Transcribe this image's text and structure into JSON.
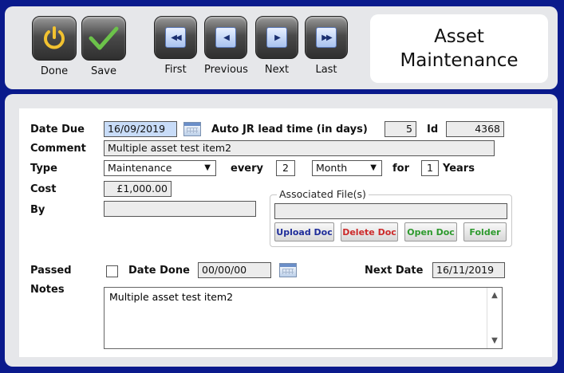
{
  "toolbar": {
    "done_label": "Done",
    "save_label": "Save",
    "first_label": "First",
    "previous_label": "Previous",
    "next_label": "Next",
    "last_label": "Last",
    "title_line1": "Asset",
    "title_line2": "Maintenance"
  },
  "icons": {
    "done": "power-icon",
    "save": "checkmark-icon",
    "first": "first-record-icon",
    "previous": "previous-record-icon",
    "next": "next-record-icon",
    "last": "last-record-icon"
  },
  "form": {
    "date_due_label": "Date Due",
    "date_due_value": "16/09/2019",
    "lead_time_label": "Auto JR lead time (in days)",
    "lead_time_value": "5",
    "id_label": "Id",
    "id_value": "4368",
    "comment_label": "Comment",
    "comment_value": "Multiple asset test item2",
    "type_label": "Type",
    "type_value": "Maintenance",
    "every_label": "every",
    "every_value": "2",
    "period_value": "Month",
    "for_label": "for",
    "for_value": "1",
    "years_label": "Years",
    "cost_label": "Cost",
    "cost_value": "£1,000.00",
    "by_label": "By",
    "by_value": "",
    "passed_label": "Passed",
    "passed_checked": false,
    "date_done_label": "Date Done",
    "date_done_value": "00/00/00",
    "next_date_label": "Next Date",
    "next_date_value": "16/11/2019",
    "notes_label": "Notes",
    "notes_value": "Multiple asset test item2"
  },
  "associated_files": {
    "legend": "Associated File(s)",
    "file_value": "",
    "upload_label": "Upload Doc",
    "delete_label": "Delete Doc",
    "open_label": "Open Doc",
    "folder_label": "Folder"
  },
  "colors": {
    "background": "#0a1a8c",
    "panel": "#e6e7ea",
    "done_icon": "#f2c230",
    "save_icon": "#6cc24a",
    "upload": "#1f2d9a",
    "delete": "#cc2a2a",
    "open": "#2e9a2e",
    "folder": "#2e9a2e"
  }
}
